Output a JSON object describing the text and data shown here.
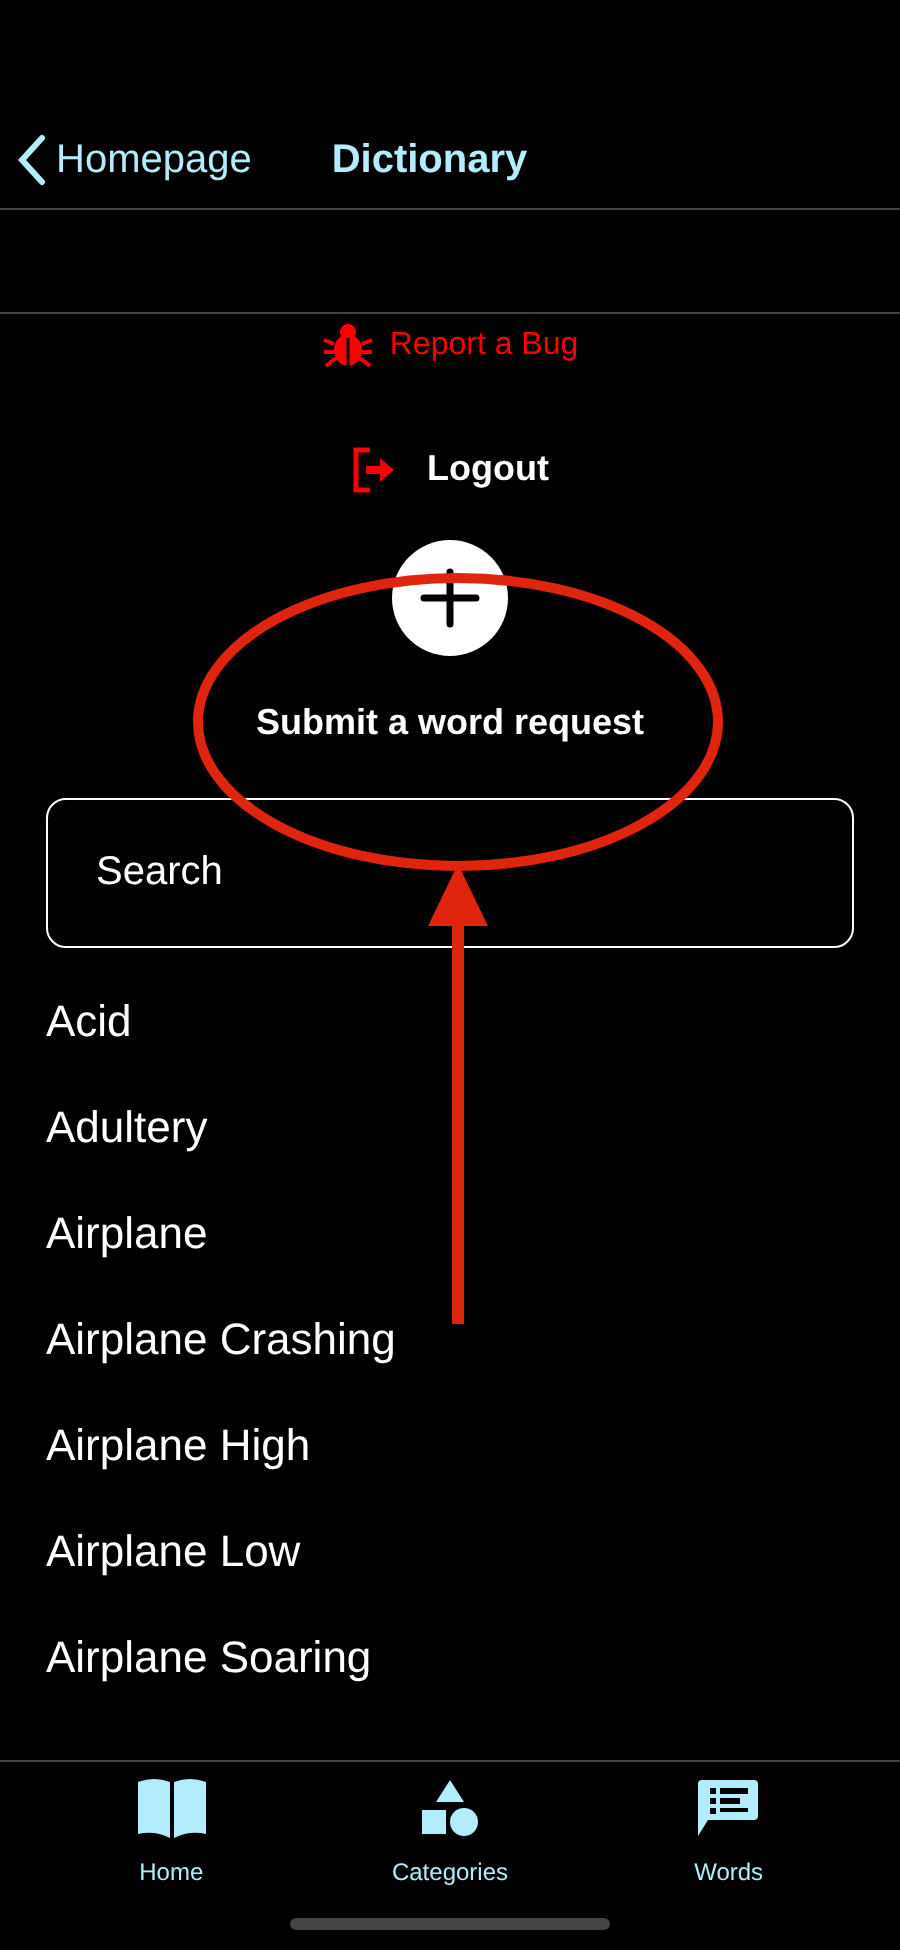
{
  "nav": {
    "back": "Homepage",
    "title": "Dictionary"
  },
  "report_bug": "Report a Bug",
  "logout": "Logout",
  "submit": "Submit a word request",
  "search": {
    "placeholder": "Search"
  },
  "words": [
    "Acid",
    "Adultery",
    "Airplane",
    "Airplane Crashing",
    "Airplane High",
    "Airplane Low",
    "Airplane Soaring"
  ],
  "tab_bar": [
    {
      "label": "Home",
      "kind": "book"
    },
    {
      "label": "Categories",
      "kind": "shapes"
    },
    {
      "label": "Words",
      "kind": "list"
    }
  ]
}
